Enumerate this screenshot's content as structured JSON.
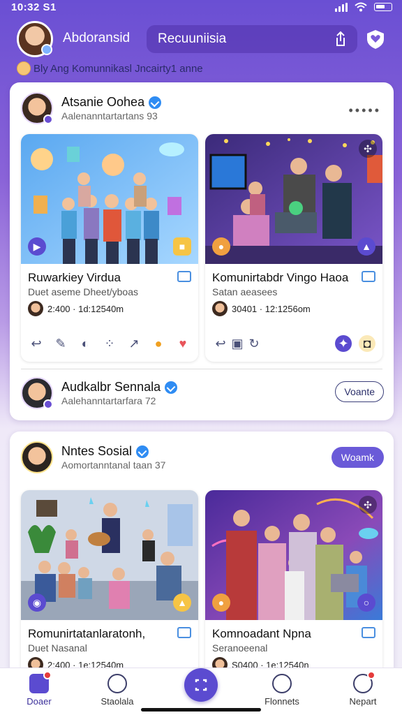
{
  "status_bar": {
    "time": "10:32 S1"
  },
  "header": {
    "name": "Abdoransid",
    "search_text": "Recuuniisia"
  },
  "subline": {
    "text": "Bly  Ang Komunnikasl Jncairty1  anne"
  },
  "card1": {
    "author": {
      "name": "Atsanie Oohea",
      "sub": "Aalenanntartartans 93"
    },
    "tiles": [
      {
        "title": "Ruwarkiey Virdua",
        "sub": "Duet aseme Dheet/yboas",
        "meta": "2:400  ·  1d:12540m"
      },
      {
        "title": "Komunirtabdr Vingo Haoa",
        "sub": "Satan aeasees",
        "meta": "30401  ·  12:1256om"
      }
    ],
    "author2": {
      "name": "Audkalbr Sennala",
      "sub": "Aalehanntartarfara 72"
    },
    "follow_label": "Voante"
  },
  "card2": {
    "author": {
      "name": "Nntes Sosial",
      "sub": "Aomortanntanal taan 37"
    },
    "join_label": "Woamk",
    "tiles": [
      {
        "title": "Romunirtatanlaratonh,",
        "sub": "Duet Nasanal",
        "meta": "2:400  ·  1e:12540m"
      },
      {
        "title": "Komnoadant Npna",
        "sub": "Seranoeenal",
        "meta": "S0400  ·  1e:12540n"
      }
    ]
  },
  "bottom_nav": {
    "items": [
      {
        "label": "Doaer"
      },
      {
        "label": "Staolala"
      },
      {
        "label": "Flonnets"
      },
      {
        "label": "Nepart"
      }
    ]
  }
}
